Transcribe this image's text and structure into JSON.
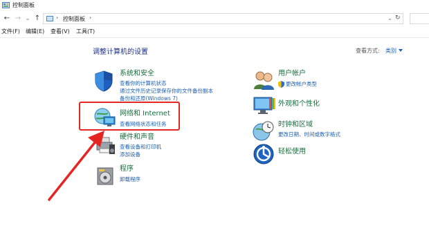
{
  "window": {
    "title": "控制面板"
  },
  "nav": {
    "back": "←",
    "forward": "→",
    "dropdown": "⌄",
    "up": "↑",
    "breadcrumb_sep": "›",
    "breadcrumb": "控制面板",
    "refresh": "↻"
  },
  "menu": [
    "文件(F)",
    "编辑(E)",
    "查看(V)",
    "工具(T)"
  ],
  "header": {
    "title": "调整计算机的设置",
    "view_by_label": "查看方式:",
    "view_by_value": "类别"
  },
  "left_categories": [
    {
      "title": "系统和安全",
      "links": [
        "查看你的计算机状态",
        "通过文件历史记录保存你的文件备份副本",
        "备份和还原(Windows 7)"
      ]
    },
    {
      "title": "网络和 Internet",
      "links": [
        "查看网络状态和任务"
      ]
    },
    {
      "title": "硬件和声音",
      "links": [
        "查看设备和打印机",
        "添加设备"
      ]
    },
    {
      "title": "程序",
      "links": [
        "卸载程序"
      ]
    }
  ],
  "right_categories": [
    {
      "title": "用户帐户",
      "links": [
        "更改帐户类型"
      ]
    },
    {
      "title": "外观和个性化",
      "links": []
    },
    {
      "title": "时钟和区域",
      "links": [
        "更改日期、时间或数字格式"
      ]
    },
    {
      "title": "轻松使用",
      "links": []
    }
  ],
  "colors": {
    "heading": "#1e3287",
    "category": "#196f3d",
    "link": "#1a5fb4",
    "highlight": "#e52521"
  }
}
